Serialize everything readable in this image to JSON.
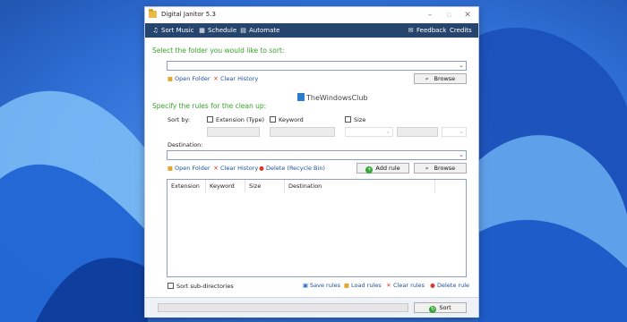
{
  "window": {
    "title": "Digital Janitor 5.3"
  },
  "menu": {
    "sort_music": "Sort Music",
    "schedule": "Schedule",
    "automate": "Automate",
    "feedback": "Feedback",
    "credits": "Credits"
  },
  "folder_section": {
    "title": "Select the folder you would like to sort:",
    "folder_value": "",
    "open_folder": "Open Folder",
    "clear_history": "Clear History",
    "browse": "Browse"
  },
  "watermark": "TheWindowsClub",
  "rules_section": {
    "title": "Specify the rules for the clean up:",
    "sort_by_label": "Sort by:",
    "extension_label": "Extension (Type)",
    "keyword_label": "Keyword",
    "size_label": "Size",
    "destination_label": "Destination:",
    "open_folder": "Open Folder",
    "clear_history": "Clear History",
    "delete_label": "Delete (Recycle Bin)",
    "add_rule": "Add rule",
    "browse": "Browse"
  },
  "rules_table": {
    "columns": [
      "Extension",
      "Keyword",
      "Size",
      "Destination"
    ],
    "rows": []
  },
  "bottom": {
    "sort_subdirs": "Sort sub-directories",
    "save_rules": "Save rules",
    "load_rules": "Load rules",
    "clear_rules": "Clear rules",
    "delete_rule": "Delete rule"
  },
  "status": {
    "progress_percent": 0,
    "sort_button": "Sort"
  },
  "colors": {
    "accent_green": "#39a32a",
    "menubar_bg": "#26456d",
    "link_blue": "#1f4f99",
    "delete_red": "#d93a2b",
    "add_green": "#37a538"
  }
}
